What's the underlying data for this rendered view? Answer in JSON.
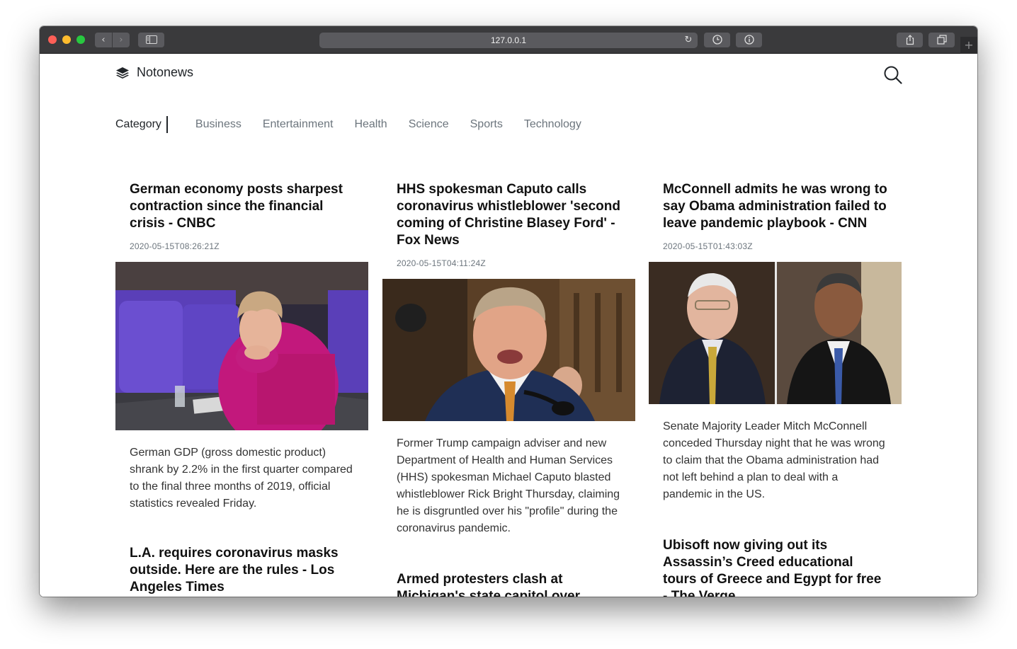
{
  "browser": {
    "url": "127.0.0.1",
    "back_glyph": "‹",
    "forward_glyph": "›",
    "reload_glyph": "↻",
    "newtab_glyph": "+"
  },
  "site": {
    "brand": "Notonews",
    "brand_icon": "layers-icon",
    "search_icon": "search-icon"
  },
  "categories": {
    "label": "Category",
    "items": [
      "Business",
      "Entertainment",
      "Health",
      "Science",
      "Sports",
      "Technology"
    ]
  },
  "articles": [
    {
      "title": "German economy posts sharpest contraction since the financial crisis - CNBC",
      "date": "2020-05-15T08:26:21Z",
      "image_alt": "Woman in magenta jacket seated in parliament",
      "description": "German GDP (gross domestic product) shrank by 2.2% in the first quarter compared to the final three months of 2019, official statistics revealed Friday."
    },
    {
      "title": "HHS spokesman Caputo calls coronavirus whistleblower 'second coming of Christine Blasey Ford' - Fox News",
      "date": "2020-05-15T04:11:24Z",
      "image_alt": "Man speaking into a microphone at a hearing",
      "description": "Former Trump campaign adviser and new Department of Health and Human Services (HHS) spokesman Michael Caputo blasted whistleblower Rick Bright Thursday, claiming he is disgruntled over his \"profile\" during the coronavirus pandemic."
    },
    {
      "title": "McConnell admits he was wrong to say Obama administration failed to leave pandemic playbook - CNN",
      "date": "2020-05-15T01:43:03Z",
      "image_alt": "Two men in suits side by side",
      "description": "Senate Majority Leader Mitch McConnell conceded Thursday night that he was wrong to claim that the Obama administration had not left behind a plan to deal with a pandemic in the US."
    },
    {
      "title": "L.A. requires coronavirus masks outside. Here are the rules - Los Angeles Times"
    },
    {
      "title": "Armed protesters clash at Michigan's state capitol over"
    },
    {
      "title": "Ubisoft now giving out its Assassin’s Creed educational tours of Greece and Egypt for free - The Verge"
    }
  ]
}
